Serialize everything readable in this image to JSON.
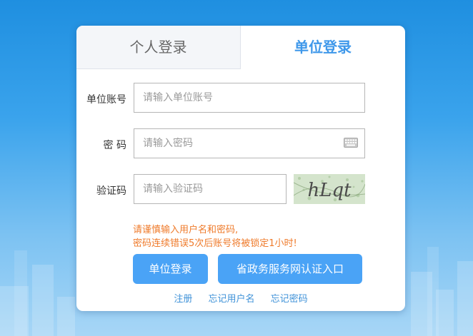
{
  "tabs": {
    "personal": "个人登录",
    "unit": "单位登录"
  },
  "form": {
    "account_label": "单位账号",
    "account_placeholder": "请输入单位账号",
    "password_label": "密 码",
    "password_placeholder": "请输入密码",
    "captcha_label": "验证码",
    "captcha_placeholder": "请输入验证码",
    "captcha_text": "hLqt"
  },
  "warning": {
    "line1": "请谨慎输入用户名和密码,",
    "line2": "密码连续错误5次后账号将被锁定1小时!"
  },
  "buttons": {
    "login": "单位登录",
    "gov_login": "省政务服务网认证入口"
  },
  "links": {
    "register": "注册",
    "forgot_username": "忘记用户名",
    "forgot_password": "忘记密码"
  },
  "colors": {
    "accent": "#4aa3f6",
    "warning": "#ef7a2a",
    "link": "#3f92d8"
  }
}
